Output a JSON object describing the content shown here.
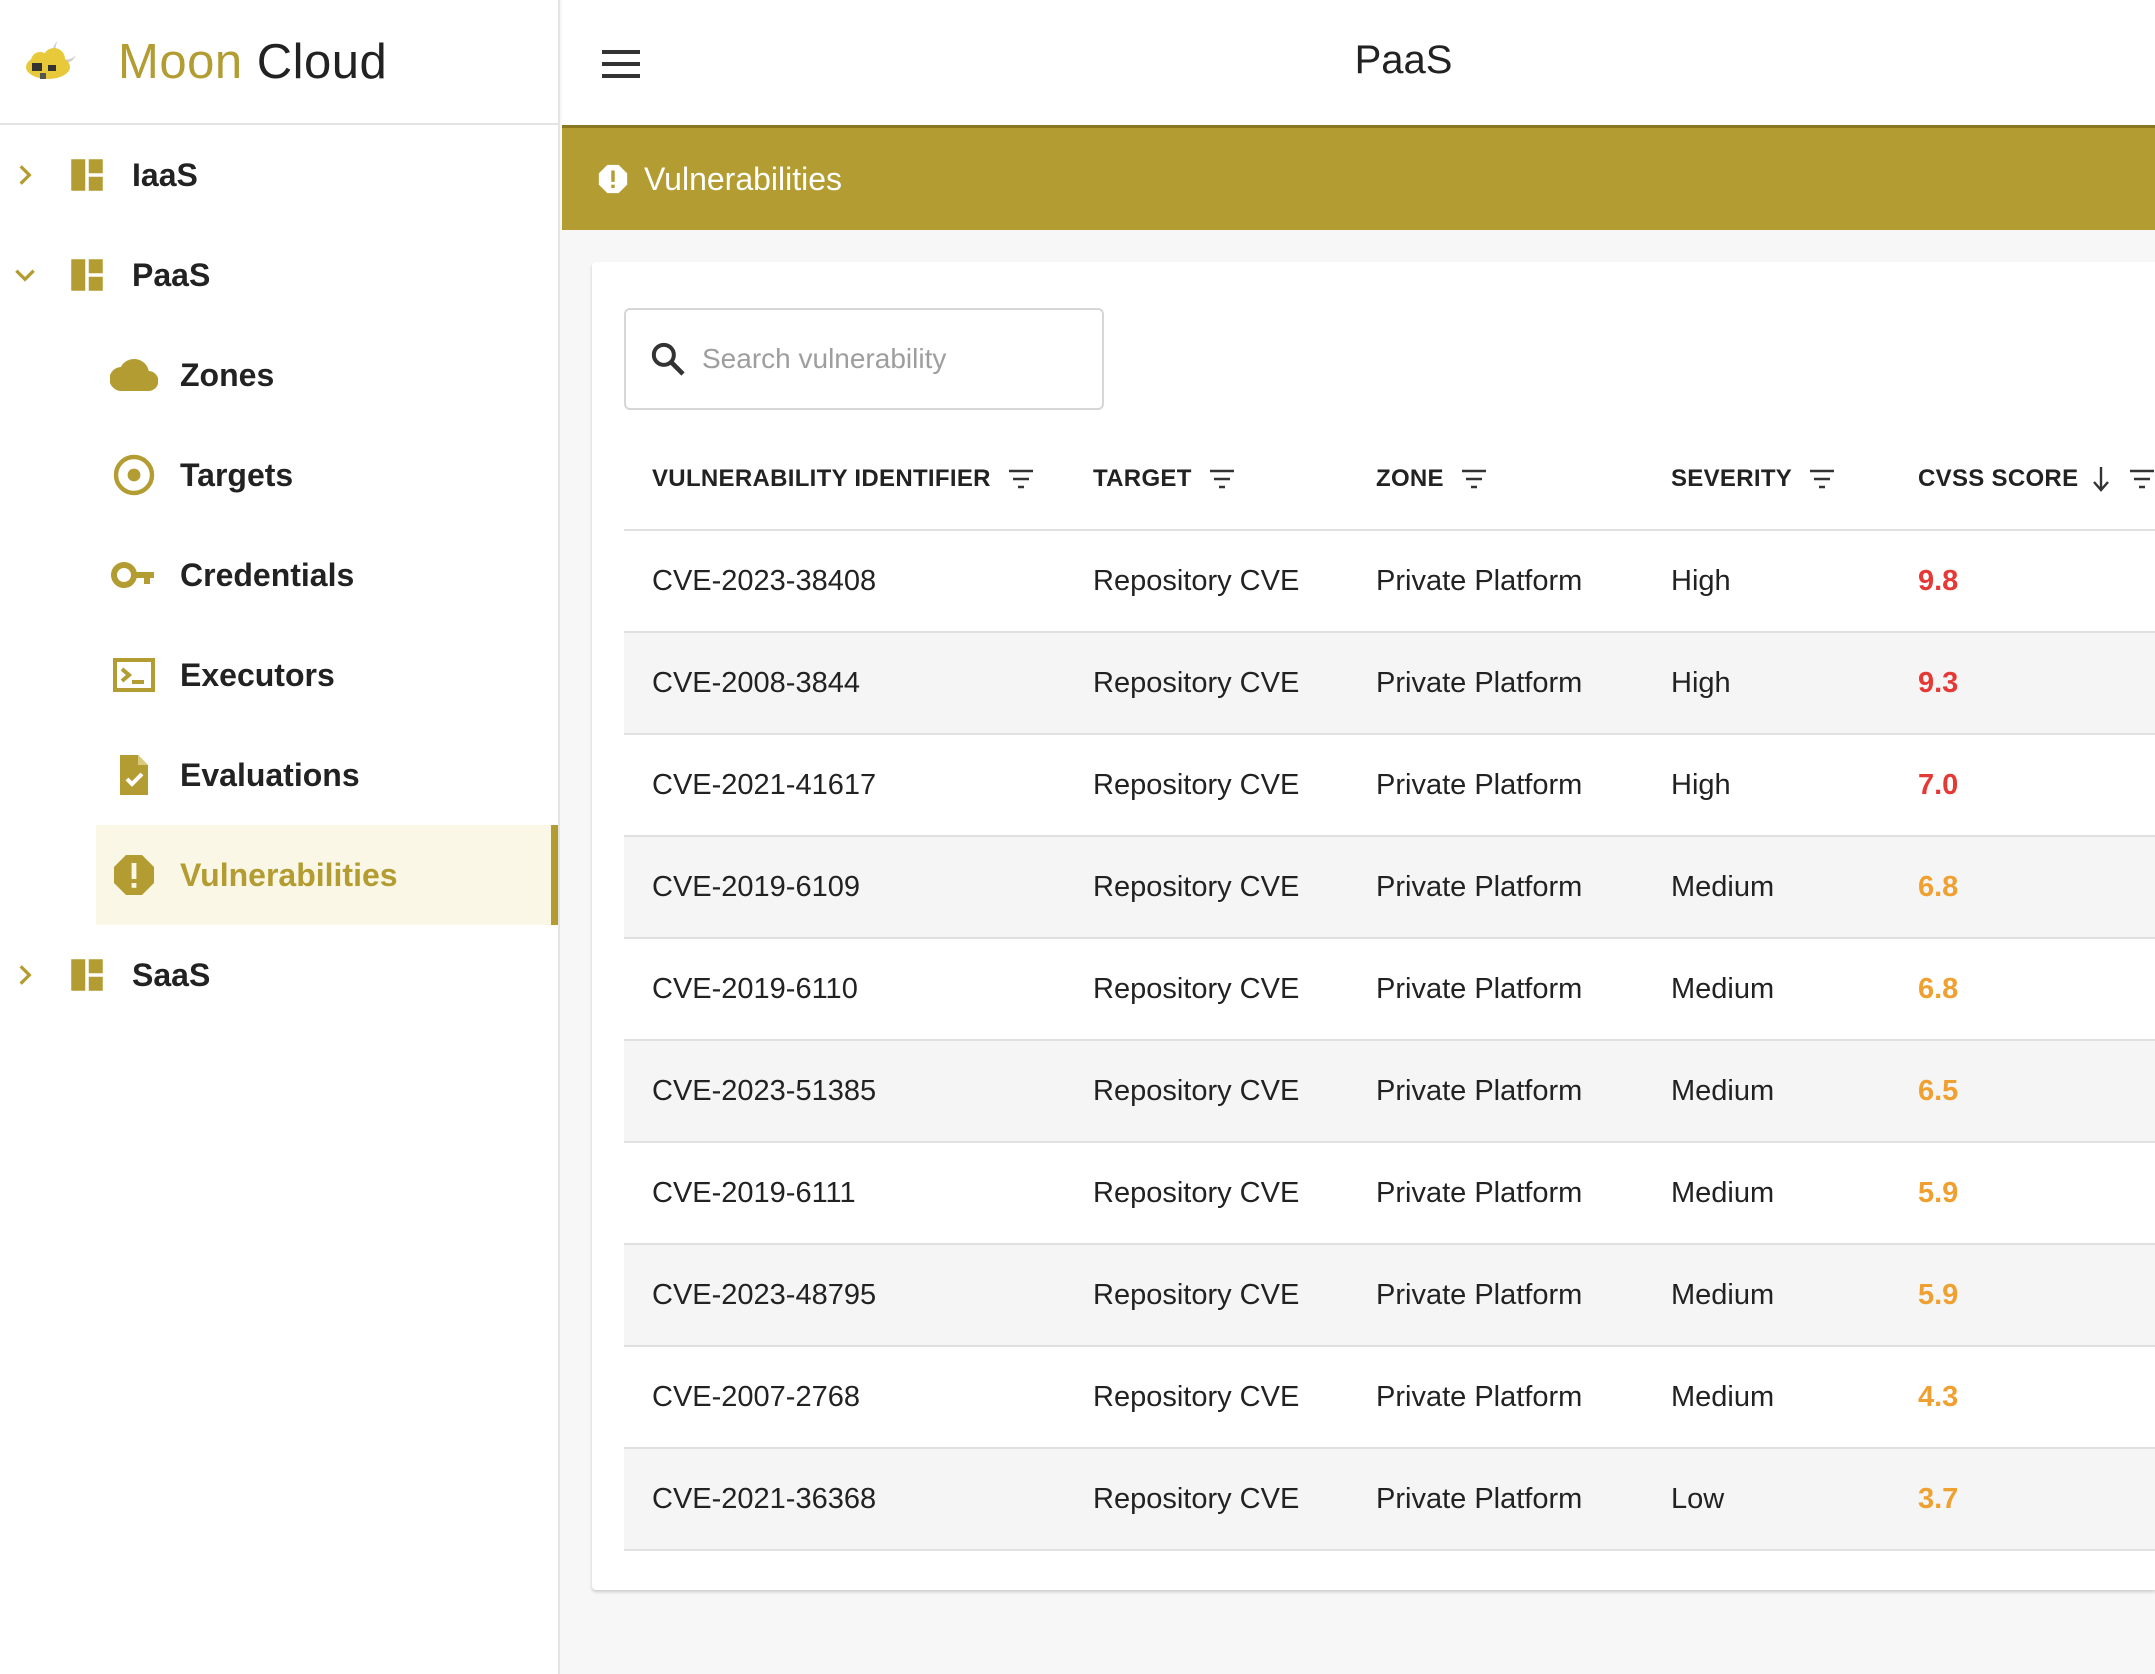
{
  "brand": {
    "name_part1": "Moon",
    "name_part2": "Cloud",
    "accent": "#b39c32"
  },
  "topbar": {
    "title": "PaaS"
  },
  "sidebar": {
    "items": [
      {
        "label": "IaaS",
        "expanded": false,
        "icon": "dashboard-icon"
      },
      {
        "label": "PaaS",
        "expanded": true,
        "icon": "dashboard-icon",
        "children": [
          {
            "label": "Zones",
            "icon": "cloud-icon"
          },
          {
            "label": "Targets",
            "icon": "target-icon"
          },
          {
            "label": "Credentials",
            "icon": "key-icon"
          },
          {
            "label": "Executors",
            "icon": "terminal-icon"
          },
          {
            "label": "Evaluations",
            "icon": "document-check-icon"
          },
          {
            "label": "Vulnerabilities",
            "icon": "alert-icon",
            "active": true
          }
        ]
      },
      {
        "label": "SaaS",
        "expanded": false,
        "icon": "dashboard-icon"
      }
    ]
  },
  "banner": {
    "title": "Vulnerabilities",
    "icon": "alert-icon"
  },
  "search": {
    "placeholder": "Search vulnerability",
    "value": ""
  },
  "table": {
    "headers": [
      "VULNERABILITY IDENTIFIER",
      "TARGET",
      "ZONE",
      "SEVERITY",
      "CVSS SCORE"
    ],
    "sort": {
      "column": "CVSS SCORE",
      "direction": "desc"
    },
    "rows": [
      {
        "id": "CVE-2023-38408",
        "target": "Repository CVE",
        "zone": "Private Platform",
        "severity": "High",
        "score": "9.8"
      },
      {
        "id": "CVE-2008-3844",
        "target": "Repository CVE",
        "zone": "Private Platform",
        "severity": "High",
        "score": "9.3"
      },
      {
        "id": "CVE-2021-41617",
        "target": "Repository CVE",
        "zone": "Private Platform",
        "severity": "High",
        "score": "7.0"
      },
      {
        "id": "CVE-2019-6109",
        "target": "Repository CVE",
        "zone": "Private Platform",
        "severity": "Medium",
        "score": "6.8"
      },
      {
        "id": "CVE-2019-6110",
        "target": "Repository CVE",
        "zone": "Private Platform",
        "severity": "Medium",
        "score": "6.8"
      },
      {
        "id": "CVE-2023-51385",
        "target": "Repository CVE",
        "zone": "Private Platform",
        "severity": "Medium",
        "score": "6.5"
      },
      {
        "id": "CVE-2019-6111",
        "target": "Repository CVE",
        "zone": "Private Platform",
        "severity": "Medium",
        "score": "5.9"
      },
      {
        "id": "CVE-2023-48795",
        "target": "Repository CVE",
        "zone": "Private Platform",
        "severity": "Medium",
        "score": "5.9"
      },
      {
        "id": "CVE-2007-2768",
        "target": "Repository CVE",
        "zone": "Private Platform",
        "severity": "Medium",
        "score": "4.3"
      },
      {
        "id": "CVE-2021-36368",
        "target": "Repository CVE",
        "zone": "Private Platform",
        "severity": "Low",
        "score": "3.7"
      }
    ]
  },
  "colors": {
    "score_high": "#e53935",
    "score_medium": "#f0a030"
  }
}
